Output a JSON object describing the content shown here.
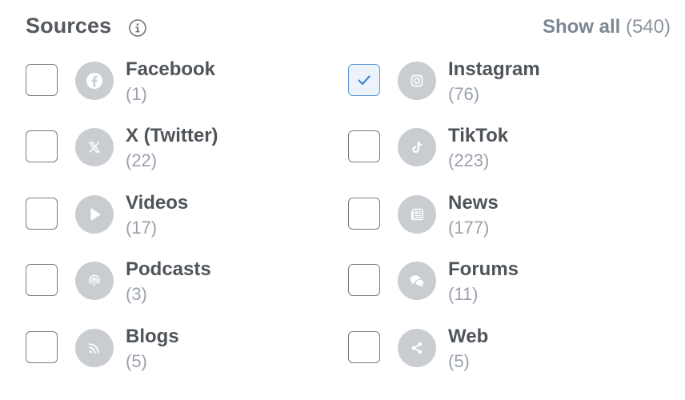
{
  "header": {
    "title": "Sources",
    "info_icon": "info-icon",
    "show_all_label": "Show all",
    "show_all_count": "(540)"
  },
  "colors": {
    "title": "#565a5f",
    "link": "#7c8794",
    "icon_bg": "#c9ccd1",
    "check_accent": "#3d8ad6"
  },
  "sources": [
    {
      "name": "Facebook",
      "count": "(1)",
      "checked": false,
      "icon": "facebook-icon"
    },
    {
      "name": "Instagram",
      "count": "(76)",
      "checked": true,
      "icon": "instagram-icon"
    },
    {
      "name": "X (Twitter)",
      "count": "(22)",
      "checked": false,
      "icon": "x-twitter-icon"
    },
    {
      "name": "TikTok",
      "count": "(223)",
      "checked": false,
      "icon": "tiktok-icon"
    },
    {
      "name": "Videos",
      "count": "(17)",
      "checked": false,
      "icon": "play-icon"
    },
    {
      "name": "News",
      "count": "(177)",
      "checked": false,
      "icon": "newspaper-icon"
    },
    {
      "name": "Podcasts",
      "count": "(3)",
      "checked": false,
      "icon": "podcast-icon"
    },
    {
      "name": "Forums",
      "count": "(11)",
      "checked": false,
      "icon": "chat-bubbles-icon"
    },
    {
      "name": "Blogs",
      "count": "(5)",
      "checked": false,
      "icon": "rss-icon"
    },
    {
      "name": "Web",
      "count": "(5)",
      "checked": false,
      "icon": "share-icon"
    }
  ]
}
